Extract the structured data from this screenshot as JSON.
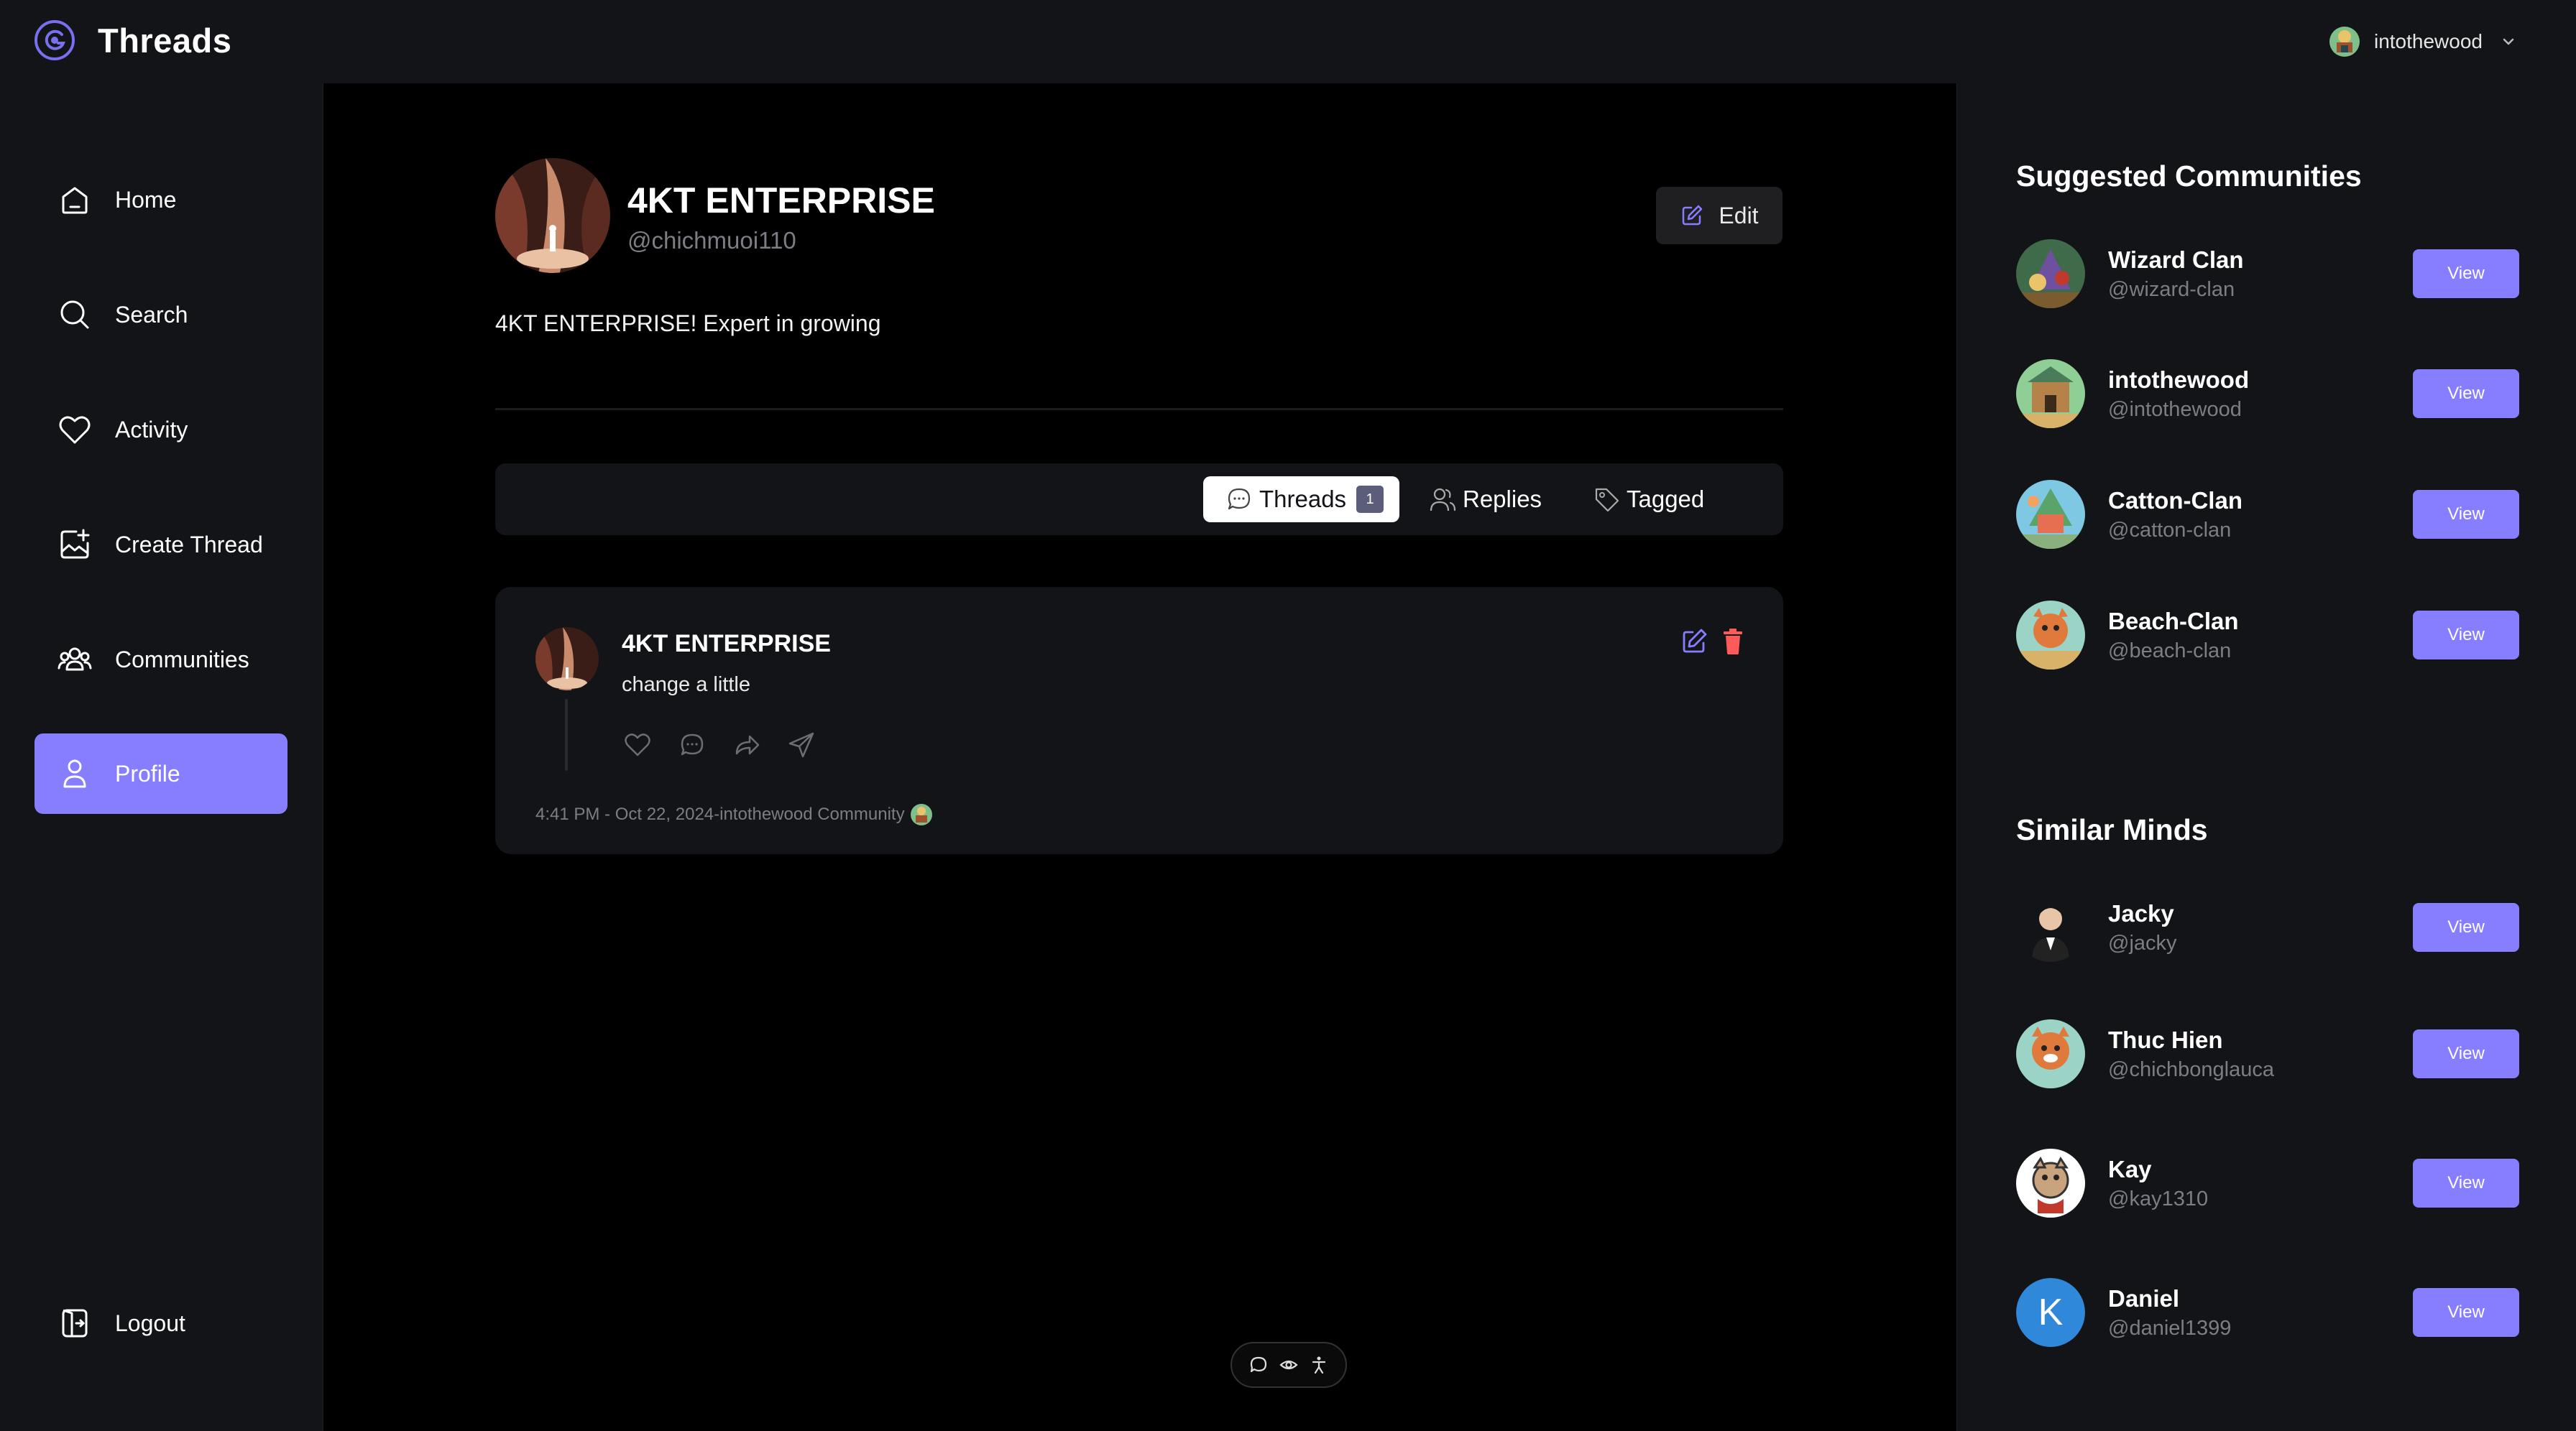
{
  "app": {
    "name": "Threads"
  },
  "topbar": {
    "username": "intothewood"
  },
  "sidebar": {
    "items": [
      {
        "label": "Home",
        "icon": "home-icon"
      },
      {
        "label": "Search",
        "icon": "search-icon"
      },
      {
        "label": "Activity",
        "icon": "heart-icon"
      },
      {
        "label": "Create Thread",
        "icon": "create-thread-icon"
      },
      {
        "label": "Communities",
        "icon": "communities-icon"
      },
      {
        "label": "Profile",
        "icon": "profile-icon",
        "active": true
      }
    ],
    "logout_label": "Logout"
  },
  "profile": {
    "name": "4KT ENTERPRISE",
    "handle": "@chichmuoi110",
    "bio": "4KT ENTERPRISE! Expert in growing",
    "edit_label": "Edit"
  },
  "tabs": [
    {
      "label": "Threads",
      "count": "1",
      "active": true,
      "icon": "chat-bubble-icon"
    },
    {
      "label": "Replies",
      "icon": "members-icon"
    },
    {
      "label": "Tagged",
      "icon": "tag-icon"
    }
  ],
  "thread": {
    "author": "4KT ENTERPRISE",
    "text": "change a little",
    "meta": "4:41 PM - Oct 22, 2024-intothewood Community"
  },
  "suggested_communities": {
    "title": "Suggested Communities",
    "items": [
      {
        "name": "Wizard Clan",
        "handle": "@wizard-clan",
        "button": "View"
      },
      {
        "name": "intothewood",
        "handle": "@intothewood",
        "button": "View"
      },
      {
        "name": "Catton-Clan",
        "handle": "@catton-clan",
        "button": "View"
      },
      {
        "name": "Beach-Clan",
        "handle": "@beach-clan",
        "button": "View"
      }
    ]
  },
  "similar_minds": {
    "title": "Similar Minds",
    "items": [
      {
        "name": "Jacky",
        "handle": "@jacky",
        "button": "View"
      },
      {
        "name": "Thuc Hien",
        "handle": "@chichbonglauca",
        "button": "View"
      },
      {
        "name": "Kay",
        "handle": "@kay1310",
        "button": "View"
      },
      {
        "name": "Daniel",
        "handle": "@daniel1399",
        "button": "View",
        "initial": "K"
      }
    ]
  },
  "colors": {
    "accent": "#877eff",
    "panel": "#121417",
    "background": "#000000",
    "muted_text": "#7d7d86",
    "delete": "#ff5a5a"
  }
}
